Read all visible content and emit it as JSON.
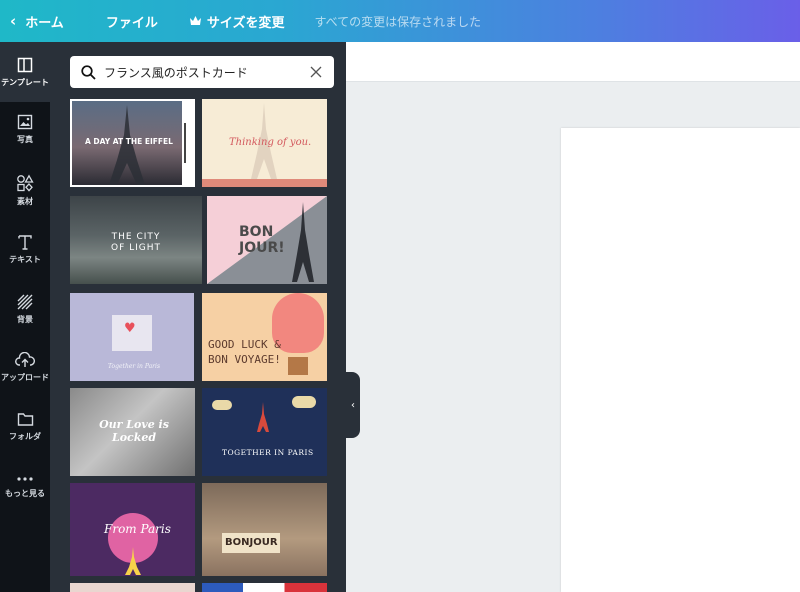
{
  "topbar": {
    "home_label": "ホーム",
    "file_label": "ファイル",
    "resize_label": "サイズを変更",
    "status_text": "すべての変更は保存されました"
  },
  "sidebar": {
    "items": [
      {
        "label": "テンプレート",
        "icon": "template-icon"
      },
      {
        "label": "写真",
        "icon": "photo-icon"
      },
      {
        "label": "素材",
        "icon": "elements-icon"
      },
      {
        "label": "テキスト",
        "icon": "text-icon"
      },
      {
        "label": "背景",
        "icon": "background-icon"
      },
      {
        "label": "アップロード",
        "icon": "upload-icon"
      },
      {
        "label": "フォルダ",
        "icon": "folder-icon"
      },
      {
        "label": "もっと見る",
        "icon": "more-icon"
      }
    ]
  },
  "search": {
    "value": "フランス風のポストカード"
  },
  "templates": [
    {
      "title": "A DAY AT THE EIFFEL"
    },
    {
      "title": "Thinking of you."
    },
    {
      "title": "THE CITY OF LIGHT"
    },
    {
      "title": "BON JOUR!"
    },
    {
      "title": "Together in Paris"
    },
    {
      "title": "GOOD LUCK & BON VOYAGE!"
    },
    {
      "title": "Our Love is Locked"
    },
    {
      "title": "TOGETHER IN PARIS"
    },
    {
      "title": "From Paris"
    },
    {
      "title": "BONJOUR"
    }
  ]
}
